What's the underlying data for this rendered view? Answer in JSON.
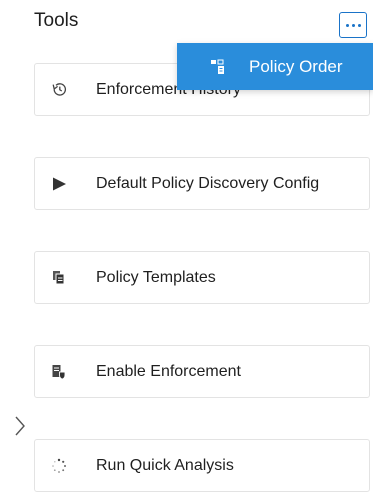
{
  "header": {
    "title": "Tools",
    "more_label": "More options"
  },
  "dropdown": {
    "items": [
      {
        "label": "Policy Order",
        "icon": "policy-order-icon"
      }
    ],
    "background_color": "#2a8ddb"
  },
  "tools": [
    {
      "label": "Enforcement History",
      "icon": "history-icon"
    },
    {
      "label": "Default Policy Discovery Config",
      "icon": "play-icon"
    },
    {
      "label": "Policy Templates",
      "icon": "templates-icon"
    },
    {
      "label": "Enable Enforcement",
      "icon": "shield-document-icon"
    },
    {
      "label": "Run Quick Analysis",
      "icon": "spinner-icon"
    }
  ],
  "accent_color": "#1a73c8"
}
